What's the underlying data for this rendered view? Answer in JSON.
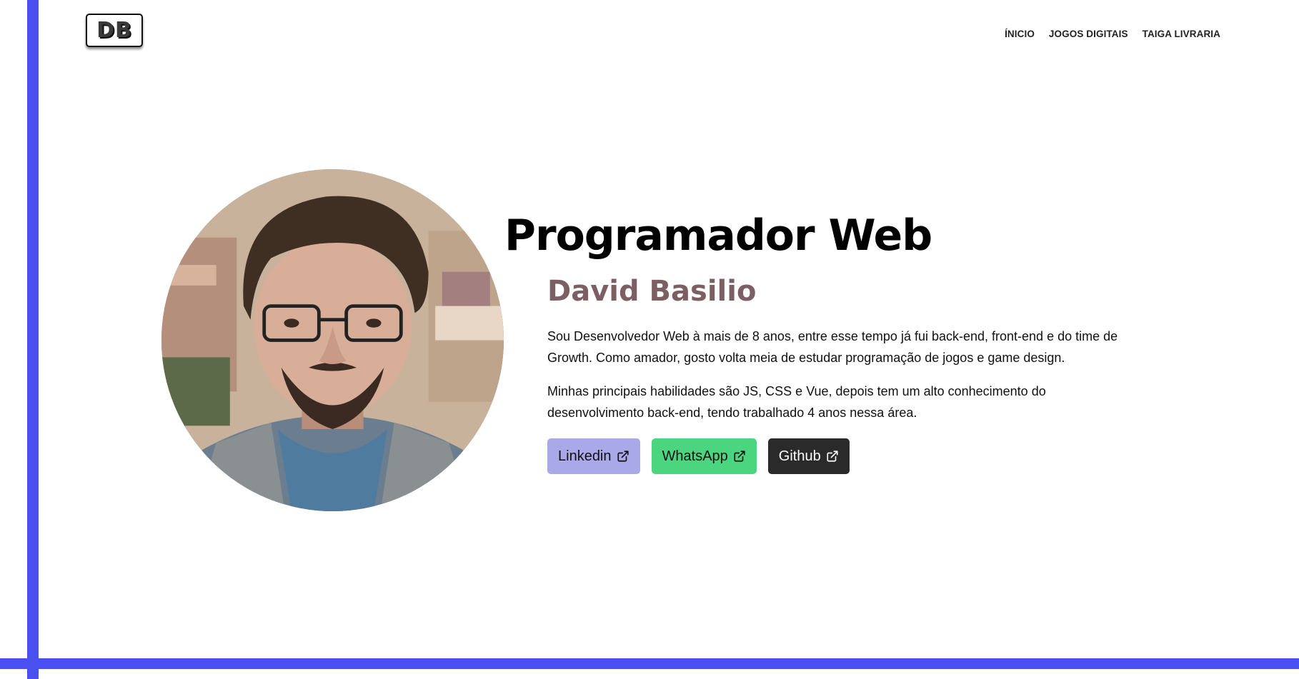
{
  "header": {
    "logo_text": "DB",
    "nav": [
      {
        "label": "ÍNICIO"
      },
      {
        "label": "JOGOS DIGITAIS"
      },
      {
        "label": "TAIGA LIVRARIA"
      }
    ]
  },
  "hero": {
    "headline": "Programador Web",
    "name": "David Basilio",
    "bio": [
      "Sou Desenvolvedor Web à mais de 8 anos, entre esse tempo já fui back-end, front-end e do time de Growth. Como amador, gosto volta meia de estudar programação de jogos e game design.",
      "Minhas principais habilidades são JS, CSS e Vue, depois tem um alto conhecimento do desenvolvimento back-end, tendo trabalhado 4 anos nessa área."
    ],
    "buttons": [
      {
        "label": "Linkedin",
        "icon": "external-link-icon",
        "color": "#a9a8e8"
      },
      {
        "label": "WhatsApp",
        "icon": "external-link-icon",
        "color": "#4cd57f"
      },
      {
        "label": "Github",
        "icon": "external-link-icon",
        "color": "#2a2a2a"
      }
    ]
  },
  "colors": {
    "frame_accent": "#4a4ff0",
    "name_color": "#7c5f62"
  }
}
